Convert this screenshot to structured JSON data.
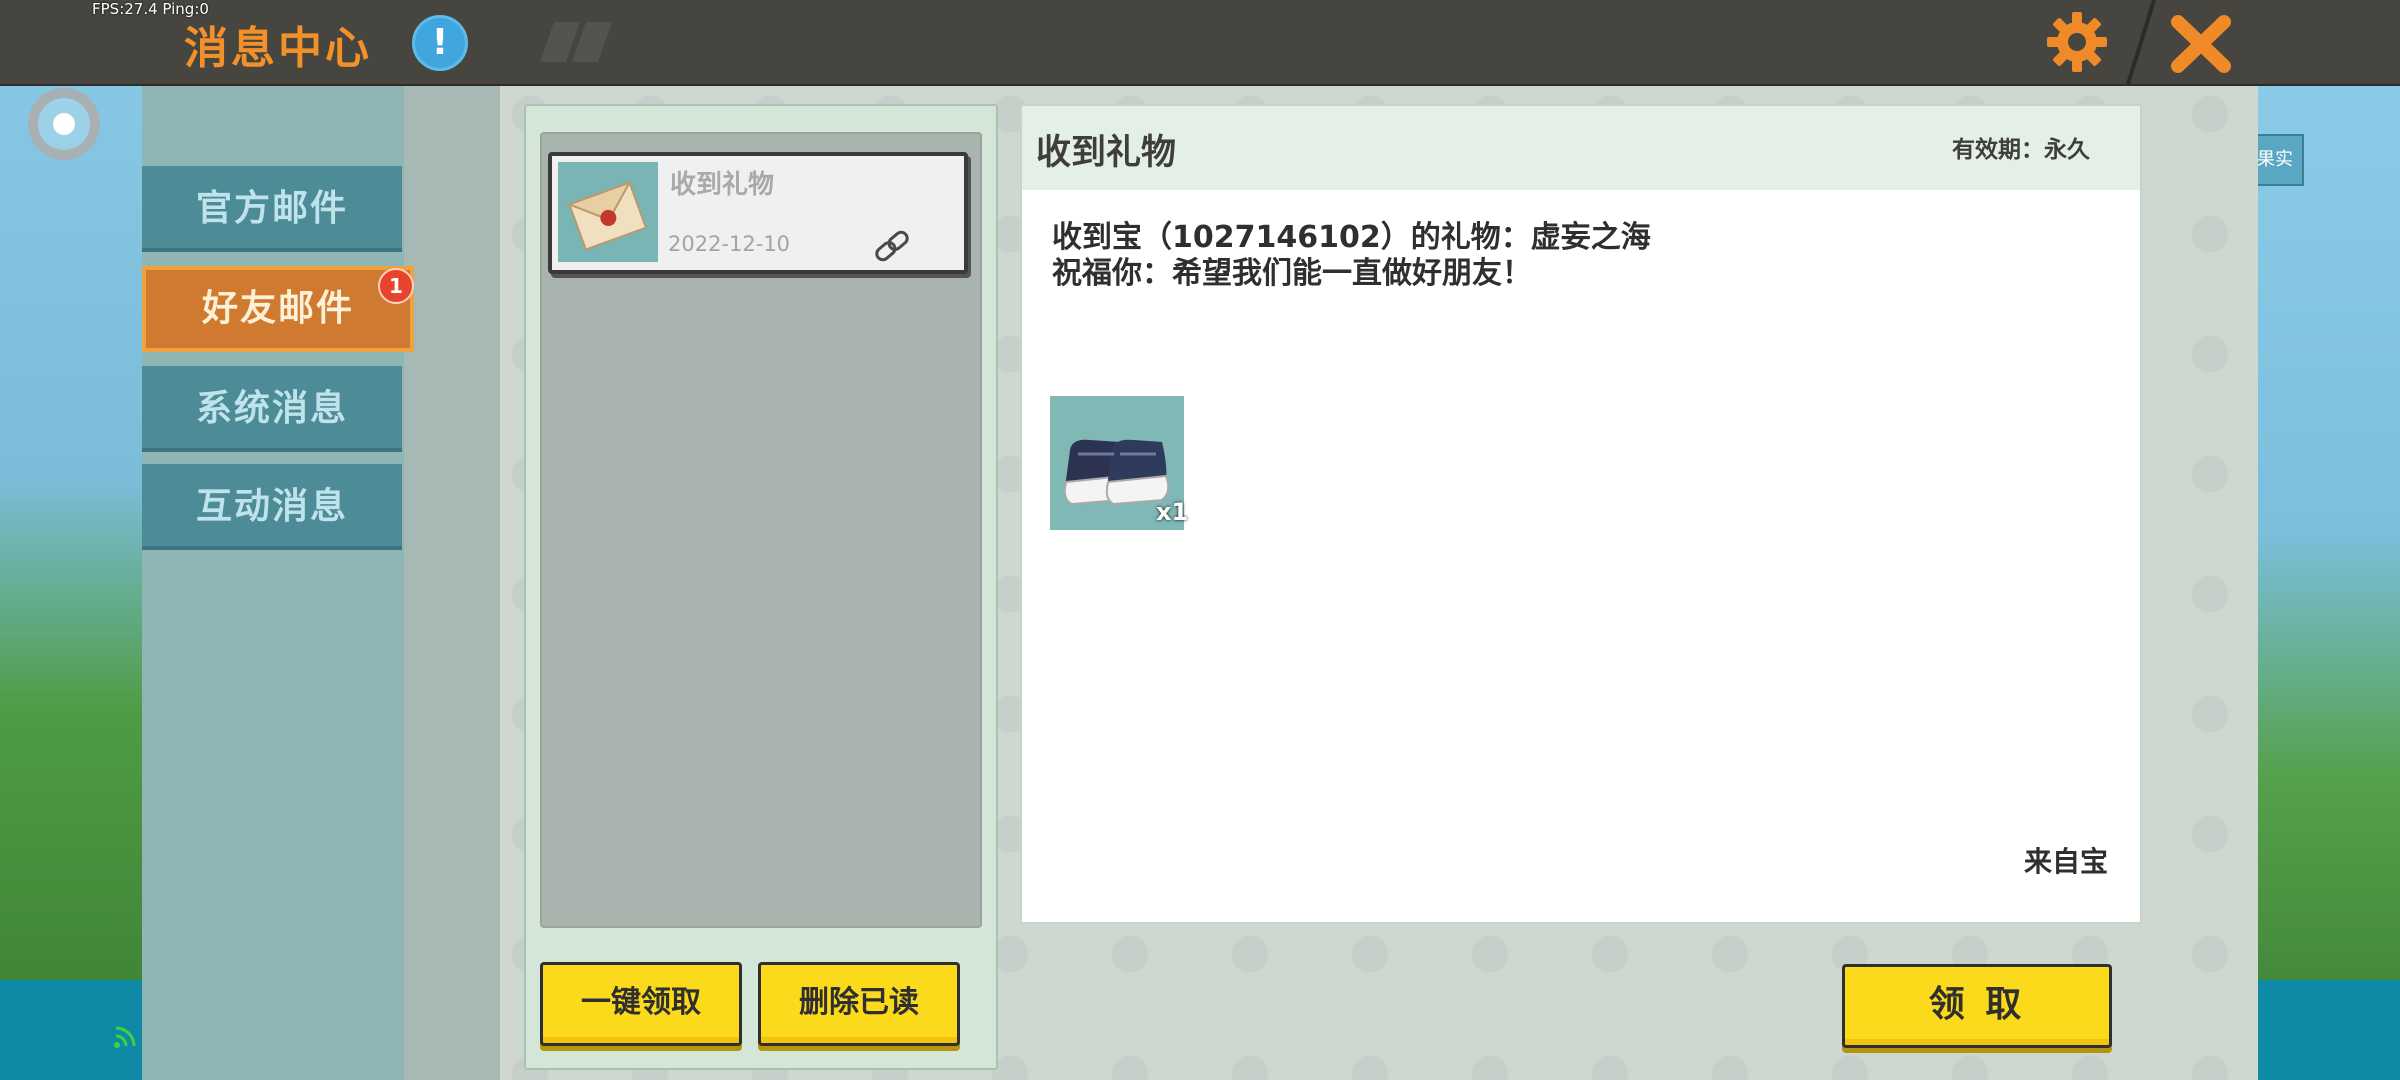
{
  "status": {
    "fps_text": "FPS:27.4  Ping:0"
  },
  "header": {
    "title": "消息中心",
    "info_icon": "!",
    "settings_icon": "gear-icon",
    "close_icon": "close-icon"
  },
  "sidebar": {
    "items": [
      {
        "label": "官方邮件",
        "active": false
      },
      {
        "label": "好友邮件",
        "active": true,
        "badge": "1"
      },
      {
        "label": "系统消息",
        "active": false
      },
      {
        "label": "互动消息",
        "active": false
      }
    ]
  },
  "mail_list": {
    "items": [
      {
        "subject": "收到礼物",
        "date": "2022-12-10",
        "has_attachment": true
      }
    ],
    "claim_all_label": "一键领取",
    "delete_read_label": "删除已读"
  },
  "detail": {
    "title": "收到礼物",
    "validity": "有效期：永久",
    "body_line1": "收到宝（1027146102）的礼物：虚妄之海",
    "body_line2": "祝福你：希望我们能一直做好朋友！",
    "gift_quantity": "x1",
    "from": "来自宝",
    "claim_label": "领 取"
  },
  "background": {
    "right_sign_text": "果实"
  },
  "colors": {
    "accent_orange": "#f2902a",
    "button_yellow": "#fbd91b",
    "tab_teal": "#4d8b97",
    "tab_active": "#cf7a30"
  }
}
